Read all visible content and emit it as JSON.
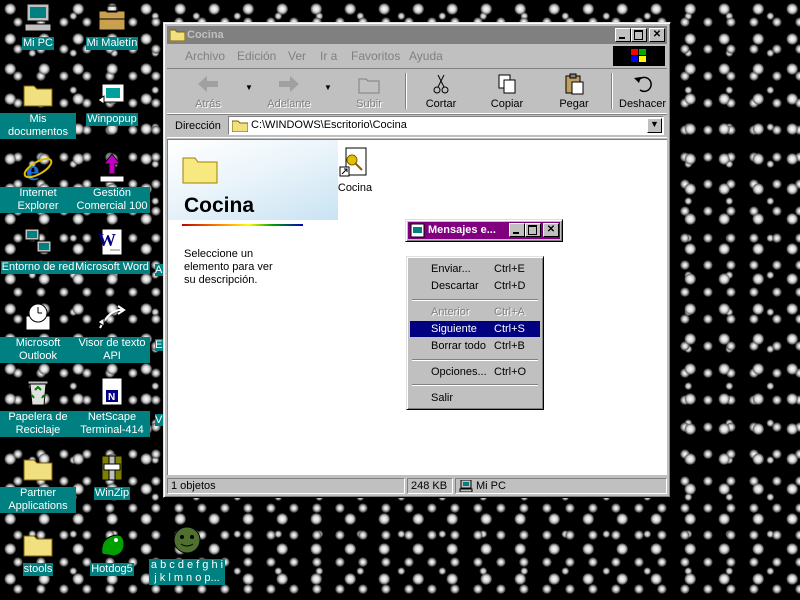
{
  "desktop_icons": [
    {
      "id": "mipc",
      "label": "Mi PC"
    },
    {
      "id": "maletin",
      "label": "Mi Maletín"
    },
    {
      "id": "misdoc",
      "label": "Mis documentos"
    },
    {
      "id": "winpopup",
      "label": "Winpopup"
    },
    {
      "id": "ie",
      "label": "Internet Explorer"
    },
    {
      "id": "gestion",
      "label": "Gestión Comercial 100"
    },
    {
      "id": "red",
      "label": "Entorno de red"
    },
    {
      "id": "word",
      "label": "Microsoft Word"
    },
    {
      "id": "outlook",
      "label": "Microsoft Outlook"
    },
    {
      "id": "visor",
      "label": "Visor de texto API"
    },
    {
      "id": "papelera",
      "label": "Papelera de Reciclaje"
    },
    {
      "id": "netscape",
      "label": "NetScape Terminal-414"
    },
    {
      "id": "partner",
      "label": "Partner Applications"
    },
    {
      "id": "winzip",
      "label": "WinZip"
    },
    {
      "id": "stools",
      "label": "stools"
    },
    {
      "id": "hotdog",
      "label": "Hotdog5"
    },
    {
      "id": "abc",
      "label": "a b c d e f g h i j k l m n o p..."
    }
  ],
  "desktop_partial_labels": [
    "A",
    "E",
    "V"
  ],
  "window": {
    "title": "Cocina",
    "menu": [
      "Archivo",
      "Edición",
      "Ver",
      "Ir a",
      "Favoritos",
      "Ayuda"
    ],
    "toolbar": {
      "back": "Atrás",
      "forward": "Adelante",
      "up": "Subir",
      "cut": "Cortar",
      "copy": "Copiar",
      "paste": "Pegar",
      "undo": "Deshacer"
    },
    "address_label": "Dirección",
    "address_value": "C:\\WINDOWS\\Escritorio\\Cocina",
    "webview": {
      "title": "Cocina",
      "description": "Seleccione un elemento para ver su descripción."
    },
    "files": [
      {
        "name": "Cocina"
      }
    ],
    "status": {
      "objects": "1 objetos",
      "size": "248 KB",
      "location": "Mi PC"
    }
  },
  "mini_window": {
    "title": "Mensajes e..."
  },
  "popup_menu": {
    "items": [
      {
        "label": "Enviar...",
        "shortcut": "Ctrl+E",
        "state": "normal"
      },
      {
        "label": "Descartar",
        "shortcut": "Ctrl+D",
        "state": "normal"
      },
      {
        "label": "Anterior",
        "shortcut": "Ctrl+A",
        "state": "disabled"
      },
      {
        "label": "Siguiente",
        "shortcut": "Ctrl+S",
        "state": "selected"
      },
      {
        "label": "Borrar todo",
        "shortcut": "Ctrl+B",
        "state": "normal"
      },
      {
        "label": "Opciones...",
        "shortcut": "Ctrl+O",
        "state": "normal"
      },
      {
        "label": "Salir",
        "shortcut": "",
        "state": "normal"
      }
    ]
  },
  "colors": {
    "desktop_label_bg": "#008080",
    "selection": "#000080",
    "inactive_title": "#808080",
    "mini_title": "#800080"
  }
}
